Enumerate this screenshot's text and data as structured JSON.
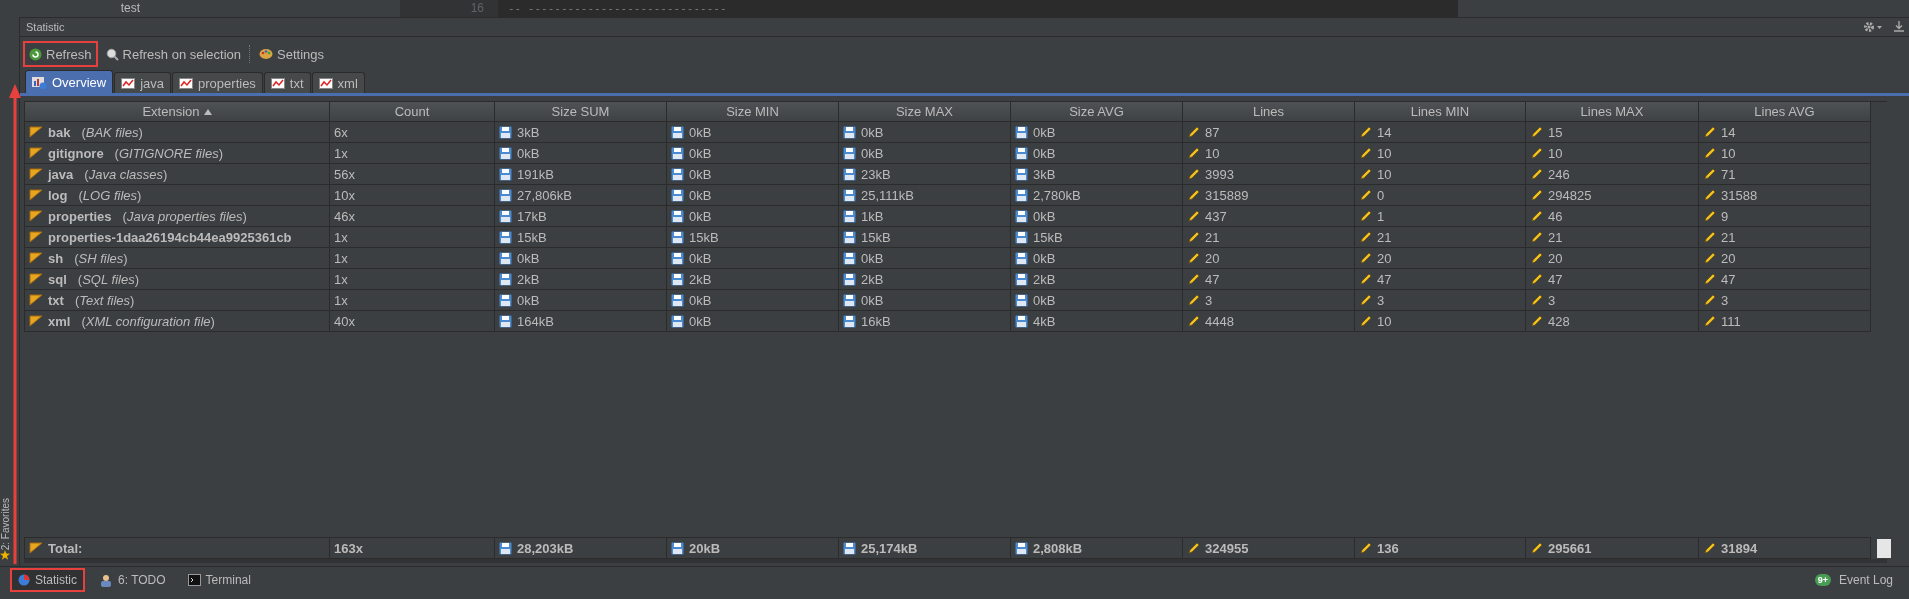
{
  "editor_strip": {
    "tree_item": "test",
    "line_number": "16",
    "code_line": "-- ------------------------------"
  },
  "panel": {
    "title": "Statistic"
  },
  "toolbar": [
    {
      "label": "Refresh",
      "kind": "refresh",
      "highlighted": true
    },
    {
      "label": "Refresh on selection",
      "kind": "refresh-selection",
      "highlighted": false
    },
    {
      "label": "Settings",
      "kind": "settings",
      "highlighted": false
    }
  ],
  "tabs": [
    {
      "label": "Overview",
      "kind": "overview",
      "selected": true
    },
    {
      "label": "java",
      "kind": "filetype",
      "selected": false
    },
    {
      "label": "properties",
      "kind": "filetype",
      "selected": false
    },
    {
      "label": "txt",
      "kind": "filetype",
      "selected": false
    },
    {
      "label": "xml",
      "kind": "filetype",
      "selected": false
    }
  ],
  "table": {
    "columns": [
      {
        "label": "Extension",
        "kind": "extension",
        "sorted": true
      },
      {
        "label": "Count",
        "kind": "count"
      },
      {
        "label": "Size SUM",
        "kind": "size"
      },
      {
        "label": "Size MIN",
        "kind": "size"
      },
      {
        "label": "Size MAX",
        "kind": "size"
      },
      {
        "label": "Size AVG",
        "kind": "size"
      },
      {
        "label": "Lines",
        "kind": "lines"
      },
      {
        "label": "Lines MIN",
        "kind": "lines"
      },
      {
        "label": "Lines MAX",
        "kind": "lines"
      },
      {
        "label": "Lines AVG",
        "kind": "lines"
      }
    ],
    "rows": [
      {
        "name": "bak",
        "description": "(*BAK files*)",
        "cells": [
          "6x",
          "3kB",
          "0kB",
          "0kB",
          "0kB",
          "87",
          "14",
          "15",
          "14"
        ]
      },
      {
        "name": "gitignore",
        "description": "(*GITIGNORE files*)",
        "cells": [
          "1x",
          "0kB",
          "0kB",
          "0kB",
          "0kB",
          "10",
          "10",
          "10",
          "10"
        ]
      },
      {
        "name": "java",
        "description": "(*Java classes*)",
        "cells": [
          "56x",
          "191kB",
          "0kB",
          "23kB",
          "3kB",
          "3993",
          "10",
          "246",
          "71"
        ]
      },
      {
        "name": "log",
        "description": "(*LOG files*)",
        "cells": [
          "10x",
          "27,806kB",
          "0kB",
          "25,111kB",
          "2,780kB",
          "315889",
          "0",
          "294825",
          "31588"
        ]
      },
      {
        "name": "properties",
        "description": "(*Java properties files*)",
        "cells": [
          "46x",
          "17kB",
          "0kB",
          "1kB",
          "0kB",
          "437",
          "1",
          "46",
          "9"
        ]
      },
      {
        "name": "properties-1daa26194cb44ea9925361cb",
        "description": "",
        "cells": [
          "1x",
          "15kB",
          "15kB",
          "15kB",
          "15kB",
          "21",
          "21",
          "21",
          "21"
        ]
      },
      {
        "name": "sh",
        "description": "(*SH files*)",
        "cells": [
          "1x",
          "0kB",
          "0kB",
          "0kB",
          "0kB",
          "20",
          "20",
          "20",
          "20"
        ]
      },
      {
        "name": "sql",
        "description": "(*SQL files*)",
        "cells": [
          "1x",
          "2kB",
          "2kB",
          "2kB",
          "2kB",
          "47",
          "47",
          "47",
          "47"
        ]
      },
      {
        "name": "txt",
        "description": "(*Text files*)",
        "cells": [
          "1x",
          "0kB",
          "0kB",
          "0kB",
          "0kB",
          "3",
          "3",
          "3",
          "3"
        ]
      },
      {
        "name": "xml",
        "description": "(*XML configuration file*)",
        "cells": [
          "40x",
          "164kB",
          "0kB",
          "16kB",
          "4kB",
          "4448",
          "10",
          "428",
          "111"
        ]
      }
    ],
    "total": {
      "label": "Total:",
      "cells": [
        "163x",
        "28,203kB",
        "20kB",
        "25,174kB",
        "2,808kB",
        "324955",
        "136",
        "295661",
        "31894"
      ]
    }
  },
  "side_strip": {
    "label": "2: Favorites"
  },
  "tool_windows": [
    {
      "label": "Statistic",
      "kind": "statistic",
      "highlighted": true
    },
    {
      "label": "6: TODO",
      "kind": "todo",
      "highlighted": false
    },
    {
      "label": "Terminal",
      "kind": "terminal",
      "highlighted": false
    }
  ],
  "event_log": {
    "label": "Event Log",
    "badge": "9+"
  }
}
